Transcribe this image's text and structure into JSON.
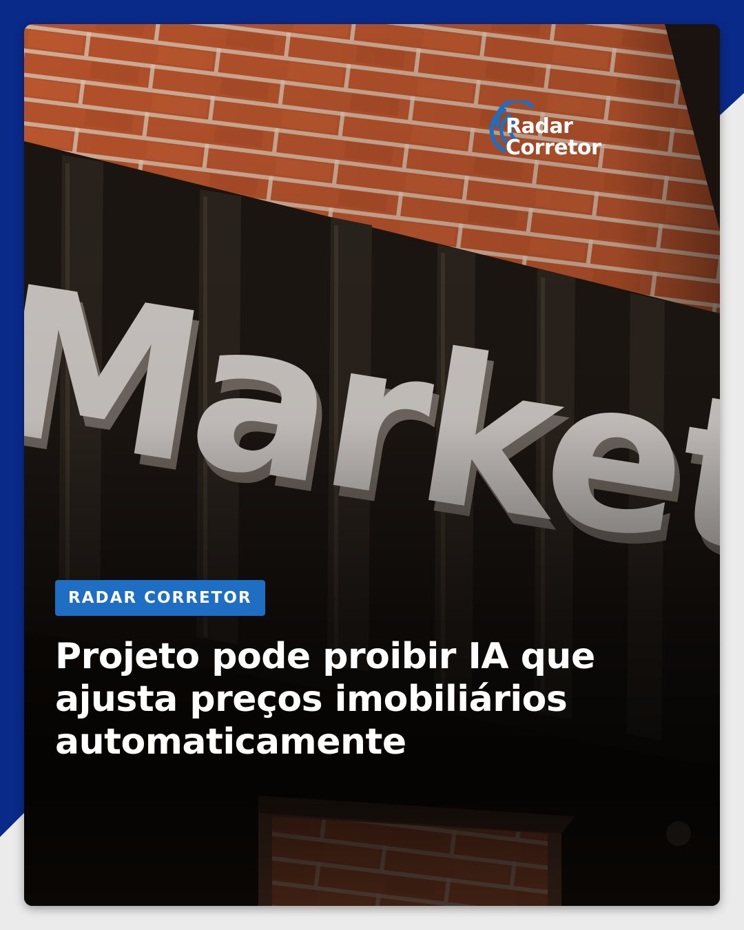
{
  "brand": {
    "logo_line1": "Radar",
    "logo_line2": "Corretor",
    "logo_icon": "radar-arcs-icon",
    "accent_color": "#1e6fc4",
    "frame_color": "#0a2a8a"
  },
  "post": {
    "category": "RADAR CORRETOR",
    "headline": "Projeto pode proibir IA que ajusta preços imobiliários automaticamente"
  },
  "photo": {
    "sign_text": "Market"
  }
}
